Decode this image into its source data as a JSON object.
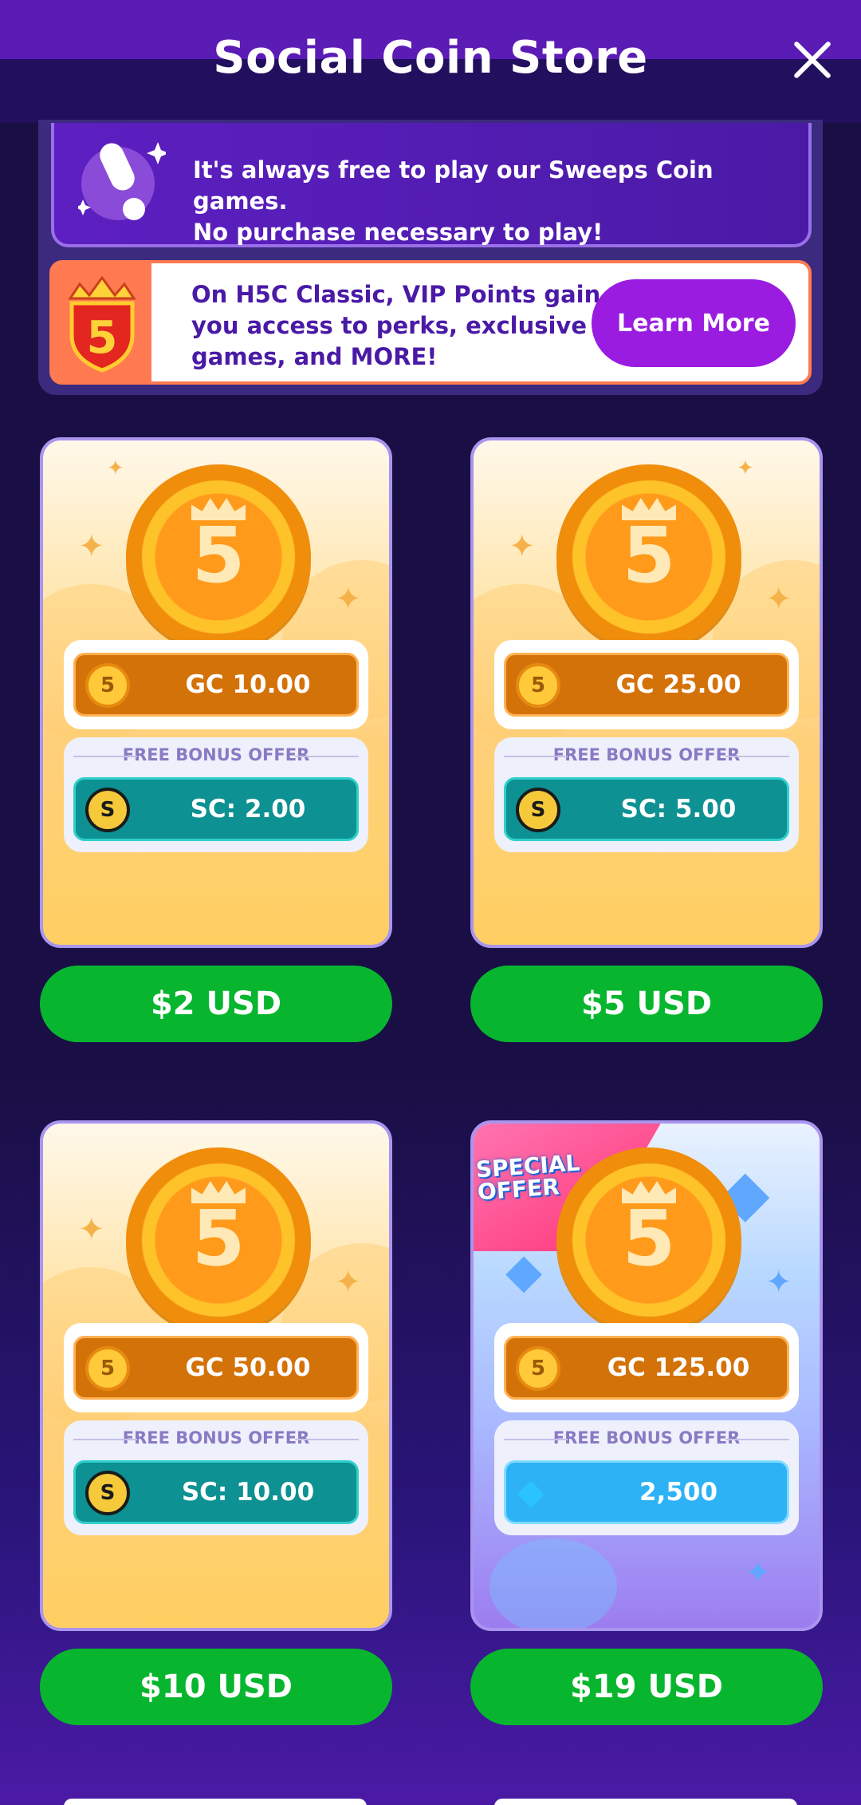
{
  "header": {
    "title": "Social Coin Store",
    "close_icon": "close-icon"
  },
  "free_banner": {
    "line1": "It's always free to play our Sweeps Coin games.",
    "line2": "No purchase necessary to play!",
    "icon": "exclamation-icon"
  },
  "vip_banner": {
    "line1": "On H5C Classic, VIP Points gain",
    "line2": "you access to perks, exclusive",
    "line3": "games, and MORE!",
    "button": "Learn More",
    "logo": "h5c-crown-logo"
  },
  "packages": [
    {
      "gc": "GC 10.00",
      "bonus_label": "FREE BONUS OFFER",
      "sc": "SC: 2.00",
      "price": "$2 USD"
    },
    {
      "gc": "GC 25.00",
      "bonus_label": "FREE BONUS OFFER",
      "sc": "SC: 5.00",
      "price": "$5 USD"
    },
    {
      "gc": "GC 50.00",
      "bonus_label": "FREE BONUS OFFER",
      "sc": "SC: 10.00",
      "price": "$10 USD"
    },
    {
      "gc": "GC 125.00",
      "bonus_label": "FREE BONUS OFFER",
      "sc": "2,500",
      "price": "$19 USD",
      "badge_line1": "SPECIAL",
      "badge_line2": "OFFER"
    }
  ],
  "colors": {
    "accent": "#9a1ce0",
    "buy": "#07b62e",
    "gold_bar": "#d4720a",
    "sweeps_bar": "#0d9192",
    "gem_bar": "#2db2f5"
  }
}
